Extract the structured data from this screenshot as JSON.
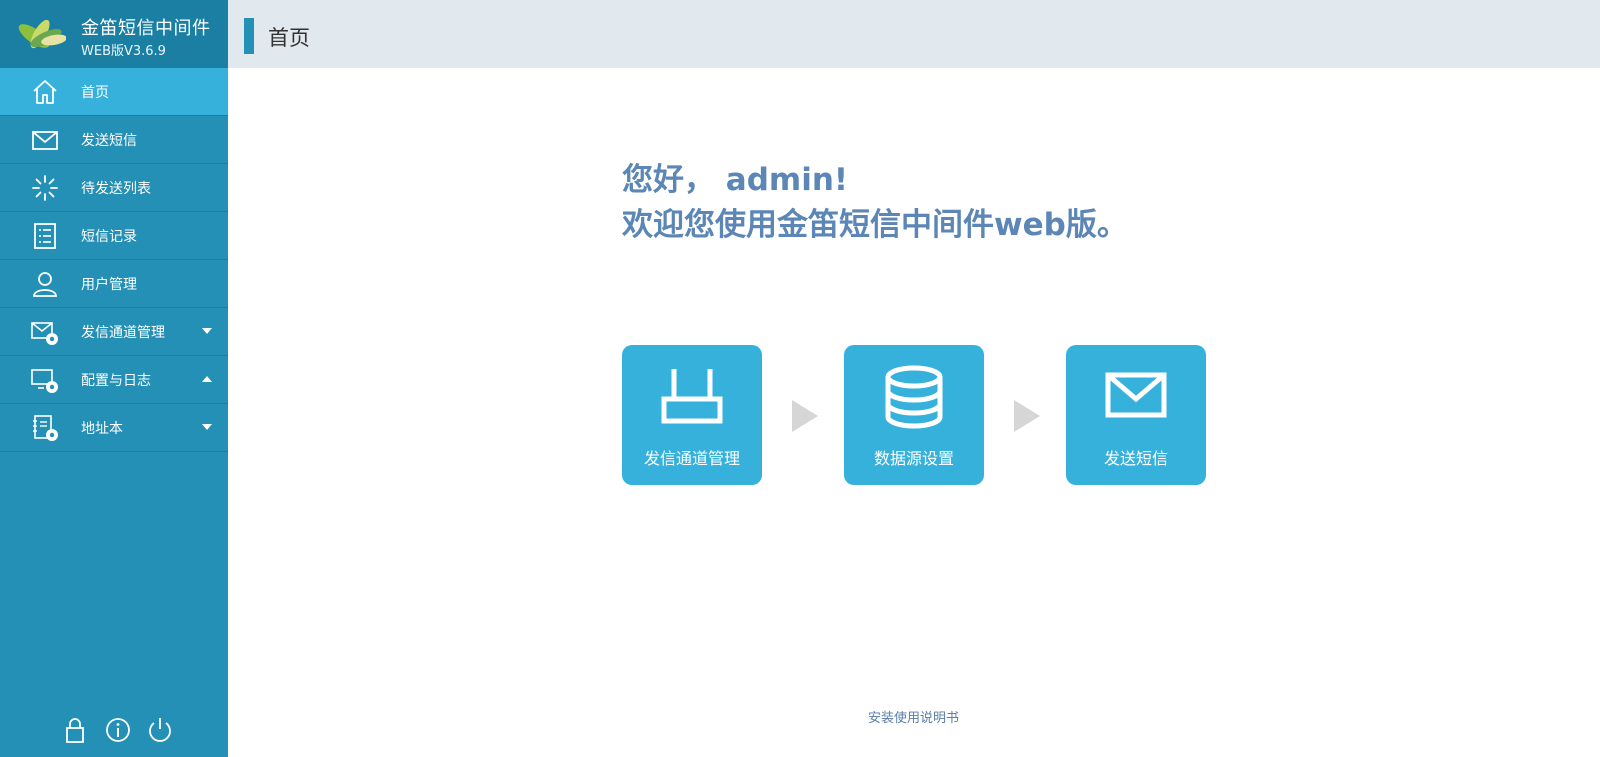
{
  "app": {
    "title": "金笛短信中间件",
    "version": "WEB版V3.6.9"
  },
  "header": {
    "title": "首页"
  },
  "sidebar": {
    "items": [
      {
        "label": "首页",
        "icon": "home-icon",
        "active": true
      },
      {
        "label": "发送短信",
        "icon": "envelope-icon"
      },
      {
        "label": "待发送列表",
        "icon": "loading-spinner-icon"
      },
      {
        "label": "短信记录",
        "icon": "list-icon"
      },
      {
        "label": "用户管理",
        "icon": "user-icon"
      },
      {
        "label": "发信通道管理",
        "icon": "envelope-gear-icon",
        "caret": "down"
      },
      {
        "label": "配置与日志",
        "icon": "monitor-gear-icon",
        "caret": "up"
      },
      {
        "label": "地址本",
        "icon": "book-gear-icon",
        "caret": "down"
      }
    ],
    "footer_icons": [
      "lock-icon",
      "info-icon",
      "power-icon"
    ]
  },
  "main": {
    "greeting": "您好， admin!",
    "welcome": "欢迎您使用金笛短信中间件web版。",
    "tiles": [
      {
        "label": "发信通道管理",
        "icon": "router-icon"
      },
      {
        "label": "数据源设置",
        "icon": "database-icon"
      },
      {
        "label": "发送短信",
        "icon": "envelope-icon"
      }
    ],
    "manual_link": "安装使用说明书"
  },
  "colors": {
    "sidebar": "#2490b5",
    "brand_bar": "#1a7fa3",
    "active_item": "#35b1dc",
    "tile": "#35b1dc",
    "welcome_text": "#5b86b6",
    "header_bg": "#e1e8ee"
  }
}
